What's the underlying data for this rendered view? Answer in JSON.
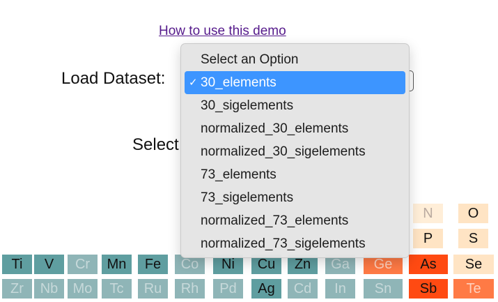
{
  "help_link": "How to use this demo",
  "labels": {
    "dataset": "Load Dataset:",
    "select_partial": "Select"
  },
  "dropdown": {
    "checkmark": "✓",
    "options": [
      "Select an Option",
      "30_elements",
      "30_sigelements",
      "normalized_30_elements",
      "normalized_30_sigelements",
      "73_elements",
      "73_sigelements",
      "normalized_73_elements",
      "normalized_73_sigelements"
    ],
    "selected": "30_elements"
  },
  "grid": {
    "row_upper": [
      "N",
      "O",
      "P",
      "S"
    ],
    "row4": [
      "Ti",
      "V",
      "Cr",
      "Mn",
      "Fe",
      "Co",
      "Ni",
      "Cu",
      "Zn",
      "Ga",
      "Ge",
      "As",
      "Se"
    ],
    "row5": [
      "Zr",
      "Nb",
      "Mo",
      "Tc",
      "Ru",
      "Rh",
      "Pd",
      "Ag",
      "Cd",
      "In",
      "Sn",
      "Sb",
      "Te"
    ]
  },
  "colors": {
    "teal": "#5f9ea0",
    "red": "#ff4a12",
    "peach": "#ffe4c4",
    "selection": "#3d95ff",
    "link": "#551a8b"
  }
}
